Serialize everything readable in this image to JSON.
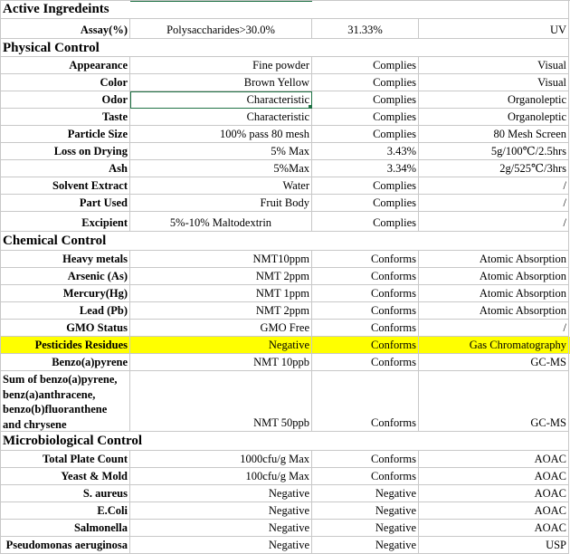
{
  "sections": {
    "active": "Active Ingredeints",
    "physical": "Physical Control",
    "chemical": "Chemical Control",
    "micro": "Microbiological Control"
  },
  "rows": {
    "assay": [
      "Assay(%)",
      "Polysaccharides>30.0%",
      "31.33%",
      "UV"
    ],
    "appearance": [
      "Appearance",
      "Fine powder",
      "Complies",
      "Visual"
    ],
    "color": [
      "Color",
      "Brown Yellow",
      "Complies",
      "Visual"
    ],
    "odor": [
      "Odor",
      "Characteristic",
      "Complies",
      "Organoleptic"
    ],
    "taste": [
      "Taste",
      "Characteristic",
      "Complies",
      "Organoleptic"
    ],
    "particle": [
      "Particle Size",
      "100% pass 80 mesh",
      "Complies",
      "80 Mesh Screen"
    ],
    "lod": [
      "Loss on Drying",
      "5% Max",
      "3.43%",
      "5g/100℃/2.5hrs"
    ],
    "ash": [
      "Ash",
      "5%Max",
      "3.34%",
      "2g/525℃/3hrs"
    ],
    "solvent": [
      "Solvent Extract",
      "Water",
      "Complies",
      "/"
    ],
    "part": [
      "Part Used",
      "Fruit Body",
      "Complies",
      "/"
    ],
    "excipient": [
      "Excipient",
      "5%-10% Maltodextrin",
      "Complies",
      "/"
    ],
    "heavy": [
      "Heavy metals",
      "NMT10ppm",
      "Conforms",
      "Atomic Absorption"
    ],
    "arsenic": [
      "Arsenic (As)",
      "NMT 2ppm",
      "Conforms",
      "Atomic Absorption"
    ],
    "mercury": [
      "Mercury(Hg)",
      "NMT 1ppm",
      "Conforms",
      "Atomic Absorption"
    ],
    "lead": [
      "Lead (Pb)",
      "NMT 2ppm",
      "Conforms",
      "Atomic Absorption"
    ],
    "gmo": [
      "GMO Status",
      "GMO Free",
      "Conforms",
      "/"
    ],
    "pesticides": [
      "Pesticides Residues",
      "Negative",
      "Conforms",
      "Gas Chromatography"
    ],
    "benzo": [
      "Benzo(a)pyrene",
      "NMT 10ppb",
      "Conforms",
      "GC-MS"
    ],
    "sum": [
      "Sum of benzo(a)pyrene, benz(a)anthracene, benzo(b)fluoranthene and chrysene",
      "NMT 50ppb",
      "Conforms",
      "GC-MS"
    ],
    "tpc": [
      "Total Plate Count",
      "1000cfu/g Max",
      "Conforms",
      "AOAC"
    ],
    "yeast": [
      "Yeast & Mold",
      "100cfu/g Max",
      "Conforms",
      "AOAC"
    ],
    "saureus": [
      "S. aureus",
      "Negative",
      "Negative",
      "AOAC"
    ],
    "ecoli": [
      "E.Coli",
      "Negative",
      "Negative",
      "AOAC"
    ],
    "salmonella": [
      "Salmonella",
      "Negative",
      "Negative",
      "AOAC"
    ],
    "pseudo": [
      "Pseudomonas aeruginosa",
      "Negative",
      "Negative",
      "USP"
    ]
  },
  "colors": {
    "highlight": "#ffff00",
    "selection": "#217346",
    "grid": "#c8c8c8"
  }
}
